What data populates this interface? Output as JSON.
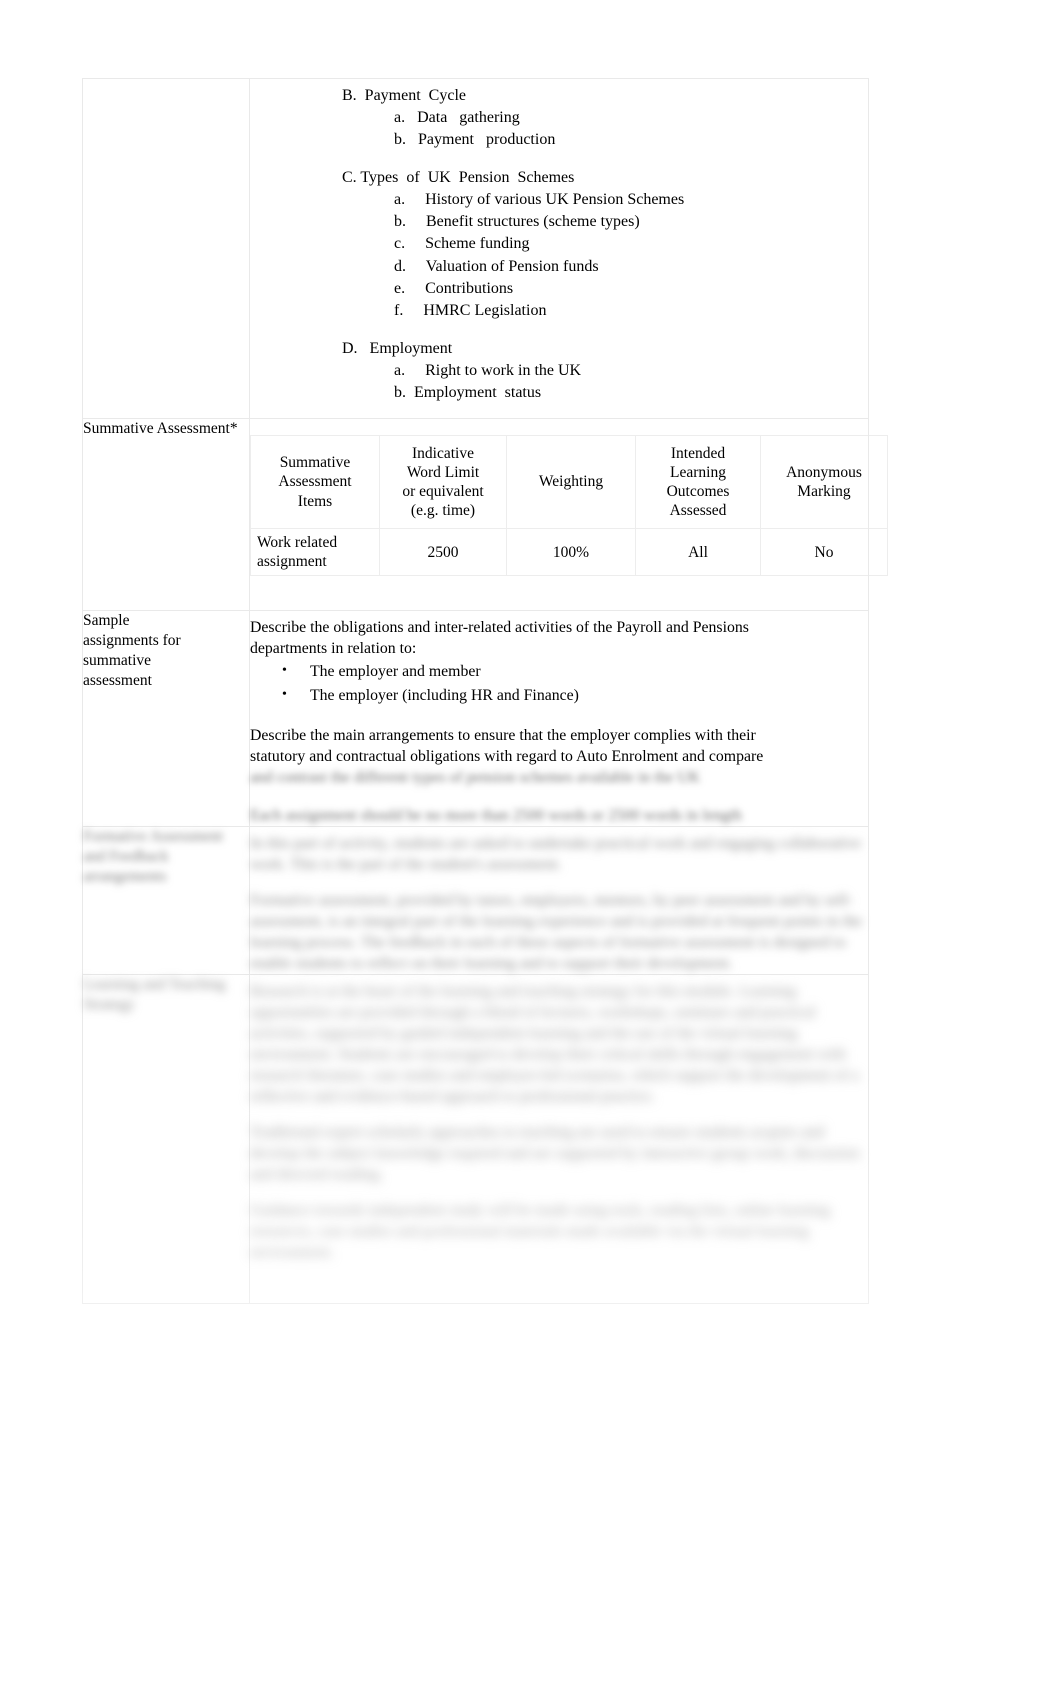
{
  "document": {
    "type": "module-specification-table"
  },
  "outline": {
    "groups": [
      {
        "head": "B.  Payment  Cycle",
        "items": [
          "a.   Data   gathering",
          "b.   Payment   production"
        ]
      },
      {
        "head": "C. Types  of  UK  Pension  Schemes",
        "items": [
          "a.     History of various UK Pension Schemes",
          "b.     Benefit structures (scheme types)",
          "c.     Scheme funding",
          "d.     Valuation of Pension funds",
          "e.     Contributions",
          "f.     HMRC Legislation"
        ]
      },
      {
        "head": "D.   Employment",
        "items": [
          "a.     Right to work in the UK",
          "b.  Employment  status"
        ]
      }
    ]
  },
  "rows": {
    "summative": {
      "label": "Summative Assessment*"
    },
    "sample": {
      "label_line1": "Sample",
      "label_line2": "assignments for",
      "label_line3": "summative",
      "label_line4": "assessment",
      "para1_line1": "Describe the obligations and inter-related activities of the Payroll and Pensions",
      "para1_line2": "departments in relation to:",
      "bullets": [
        "The employer and member",
        "The employer (including HR and Finance)"
      ],
      "para2_line1": "Describe the main arrangements to ensure that the employer complies with their",
      "para2_line2": "statutory and contractual obligations with regard to Auto Enrolment and compare",
      "para2_blurred_line3": "and contrast the different types of pension schemes available in the UK",
      "para3_blurred": "Each assignment should be no more than 2500 words or 2500 words in length"
    },
    "formative": {
      "label_blurred": "Formative Assessment and Feedback arrangements",
      "para1_blurred": "In this part of activity, students are asked to undertake practical work and engaging collaborative work. This is the part of the student's assessment.",
      "para2_blurred": "Formative assessment, provided by tutors, employers, mentors, by peer assessment and by self-assessment, is an integral part of the learning experience and is provided at frequent points in the learning process. The feedback in each of these aspects of formative assessment is designed to enable students to reflect on their learning and to support their development."
    },
    "learning_teaching": {
      "label_blurred": "Learning and Teaching Strategy",
      "para1_blurred": "Research is at the heart of the learning and teaching strategy for this module. Learning opportunities are provided through a blend of lectures, workshops, seminars and practical activities, supported by guided independent learning and the use of the virtual learning environment. Students are encouraged to develop their critical skills through engagement with research literature, case studies and employer-led scenarios, which support the development of a reflective and evidence-based approach to professional practice.",
      "para2_blurred": "Traditional expert scholarly approaches to teaching are used to ensure students acquire and develop the subject knowledge required and are supported by interactive group work, discussion and directed reading.",
      "para3_blurred": "Guidance towards independent study will be made using tools, reading lists, online learning resources, case studies and professional materials made available via the virtual learning environment."
    }
  },
  "assessment_table": {
    "headers": [
      "Summative Assessment Items",
      "Indicative Word Limit or equivalent (e.g. time)",
      "Weighting",
      "Intended Learning Outcomes Assessed",
      "Anonymous Marking"
    ],
    "header_lines": {
      "col1": [
        "Summative",
        "Assessment",
        "Items"
      ],
      "col2": [
        "Indicative",
        "Word Limit",
        "or equivalent",
        "(e.g. time)"
      ],
      "col3": [
        "Weighting"
      ],
      "col4": [
        "Intended",
        "Learning",
        "Outcomes",
        "Assessed"
      ],
      "col5": [
        "Anonymous",
        "Marking"
      ]
    },
    "rows": [
      {
        "item_line1": "Work related",
        "item_line2": "assignment",
        "word_limit": "2500",
        "weighting": "100%",
        "ilos": "All",
        "anonymous": "No"
      }
    ]
  },
  "colors": {
    "page_background": "#ffffff",
    "text": "#000000",
    "border": "#e9e9e9",
    "blurred_text": "#7a7a7a"
  }
}
